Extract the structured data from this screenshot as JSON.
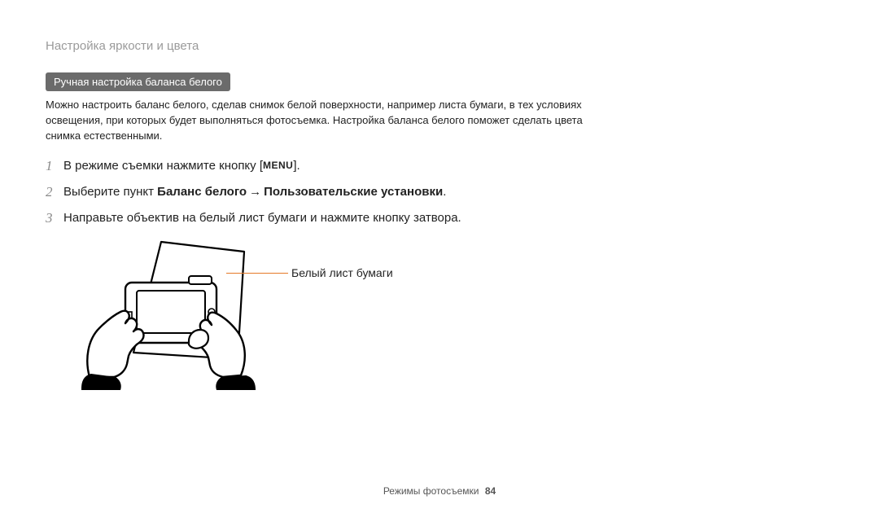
{
  "breadcrumb": "Настройка яркости и цвета",
  "sectionTitle": "Ручная настройка баланса белого",
  "intro": "Можно настроить баланс белого, сделав снимок белой поверхности, например листа бумаги, в тех условиях освещения, при которых будет выполняться фотосъемка. Настройка баланса белого поможет сделать цвета снимка естественными.",
  "steps": [
    {
      "num": "1",
      "pre": "В режиме съемки нажмите кнопку [",
      "menuLabel": "MENU",
      "post": "]."
    },
    {
      "num": "2",
      "pre": "Выберите пункт ",
      "bold1": "Баланс белого",
      "arrow": "→",
      "bold2": "Пользовательские установки",
      "post": "."
    },
    {
      "num": "3",
      "text": "Направьте объектив на белый лист бумаги и нажмите кнопку затвора."
    }
  ],
  "callout": "Белый лист бумаги",
  "footer": {
    "section": "Режимы фотосъемки",
    "page": "84"
  }
}
